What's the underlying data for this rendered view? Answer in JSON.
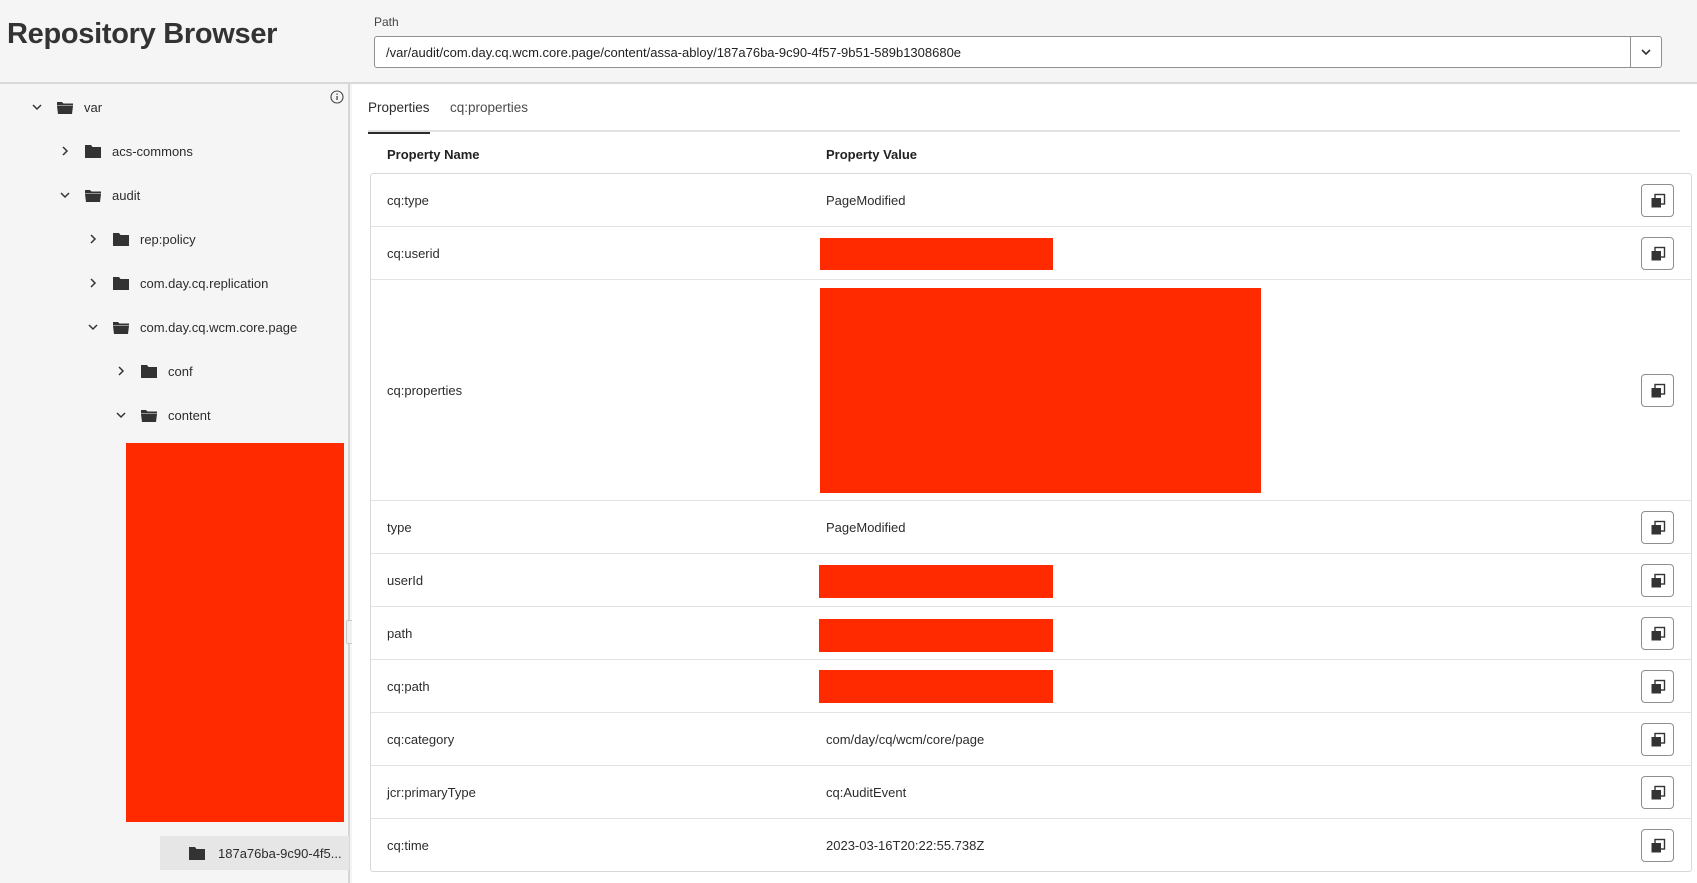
{
  "header": {
    "title": "Repository Browser",
    "path_label": "Path",
    "path_value": "/var/audit/com.day.cq.wcm.core.page/content/assa-abloy/187a76ba-9c90-4f57-9b51-589b1308680e"
  },
  "tree": {
    "items": [
      {
        "label": "var",
        "expanded": true
      },
      {
        "label": "acs-commons",
        "expanded": false
      },
      {
        "label": "audit",
        "expanded": true
      },
      {
        "label": "rep:policy",
        "expanded": false
      },
      {
        "label": "com.day.cq.replication",
        "expanded": false
      },
      {
        "label": "com.day.cq.wcm.core.page",
        "expanded": true
      },
      {
        "label": "conf",
        "expanded": false
      },
      {
        "label": "content",
        "expanded": true
      }
    ],
    "selected_label": "187a76ba-9c90-4f5..."
  },
  "tabs": [
    {
      "label": "Properties",
      "active": true
    },
    {
      "label": "cq:properties",
      "active": false
    }
  ],
  "table": {
    "col_name": "Property Name",
    "col_value": "Property Value",
    "rows": [
      {
        "name": "cq:type",
        "value": "PageModified",
        "redacted": false
      },
      {
        "name": "cq:userid",
        "value": "",
        "redacted": true
      },
      {
        "name": "cq:properties",
        "value": "",
        "redacted": true
      },
      {
        "name": "type",
        "value": "PageModified",
        "redacted": false
      },
      {
        "name": "userId",
        "value": "",
        "redacted": true
      },
      {
        "name": "path",
        "value": "",
        "redacted": true
      },
      {
        "name": "cq:path",
        "value": "",
        "redacted": true
      },
      {
        "name": "cq:category",
        "value": "com/day/cq/wcm/core/page",
        "redacted": false
      },
      {
        "name": "jcr:primaryType",
        "value": "cq:AuditEvent",
        "redacted": false
      },
      {
        "name": "cq:time",
        "value": "2023-03-16T20:22:55.738Z",
        "redacted": false
      }
    ]
  },
  "colors": {
    "redaction": "#ff2a00",
    "background": "#f5f5f5",
    "text": "#2c2c2c"
  }
}
